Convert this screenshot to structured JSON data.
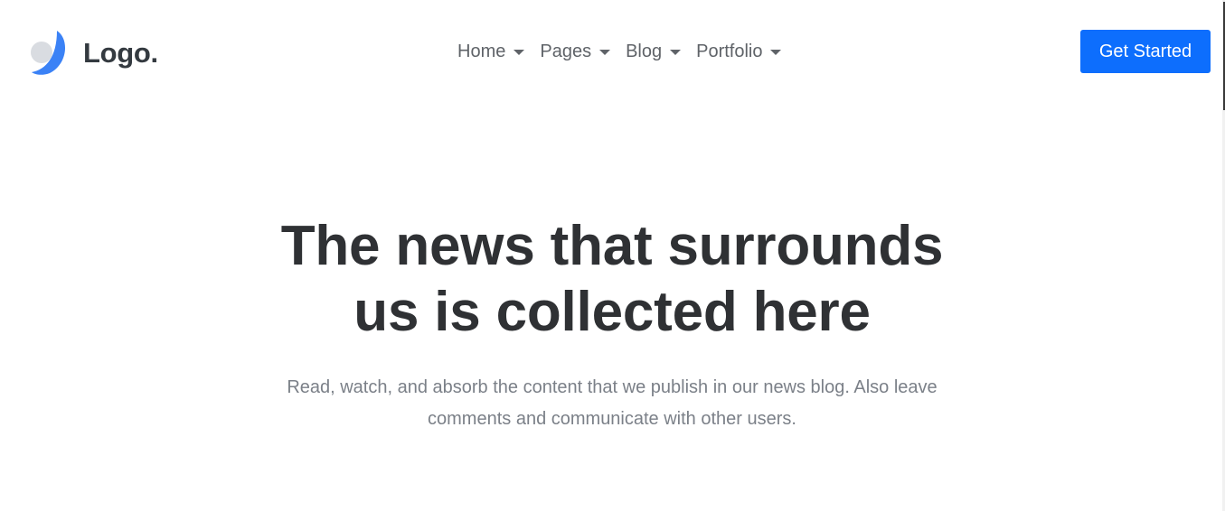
{
  "brand": {
    "logo_icon": "crescent-logo-icon",
    "name": "Logo.",
    "colors": {
      "primary": "#3b82f6",
      "secondary": "#d9dce1"
    }
  },
  "nav": {
    "items": [
      {
        "label": "Home",
        "icon": "chevron-down-icon"
      },
      {
        "label": "Pages",
        "icon": "chevron-down-icon"
      },
      {
        "label": "Blog",
        "icon": "chevron-down-icon"
      },
      {
        "label": "Portfolio",
        "icon": "chevron-down-icon"
      }
    ]
  },
  "header": {
    "cta_label": "Get Started",
    "cta_color": "#0d6efd"
  },
  "hero": {
    "title_line1": "The news that surrounds",
    "title_line2": "us is collected here",
    "subtitle_line1": "Read, watch, and absorb the content that we publish in our news blog. Also leave",
    "subtitle_line2": "comments and communicate with other users."
  }
}
